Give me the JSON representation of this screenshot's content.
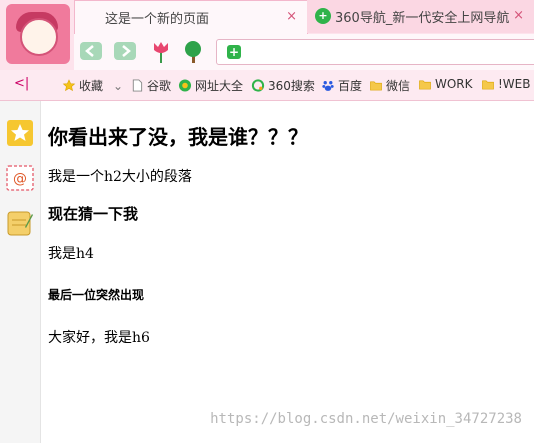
{
  "tabs": [
    {
      "title": "这是一个新的页面",
      "close": "×"
    },
    {
      "title": "360导航_新一代安全上网导航",
      "close": "×"
    }
  ],
  "bookmarks": {
    "collapse": "<|",
    "items": [
      {
        "label": "收藏",
        "icon": "star-icon"
      },
      {
        "label": "谷歌",
        "icon": "page-icon"
      },
      {
        "label": "网址大全",
        "icon": "360-nav-icon"
      },
      {
        "label": "360搜索",
        "icon": "360-search-icon"
      },
      {
        "label": "百度",
        "icon": "baidu-paw-icon"
      },
      {
        "label": "微信",
        "icon": "folder-icon"
      },
      {
        "label": "WORK",
        "icon": "folder-icon"
      },
      {
        "label": "!WEB",
        "icon": "folder-icon"
      }
    ],
    "dropdown": "⌄"
  },
  "page": {
    "h1": "你看出来了没，我是谁？？？",
    "p": "我是一个h2大小的段落",
    "h3": "现在猜一下我",
    "h4": "我是h4",
    "h5": "最后一位突然出现",
    "h6": "大家好，我是h6"
  },
  "watermark": "https://blog.csdn.net/weixin_34727238",
  "colors": {
    "chrome_pink": "#fde3ec",
    "accent": "#d45378",
    "green": "#2fb34a"
  }
}
